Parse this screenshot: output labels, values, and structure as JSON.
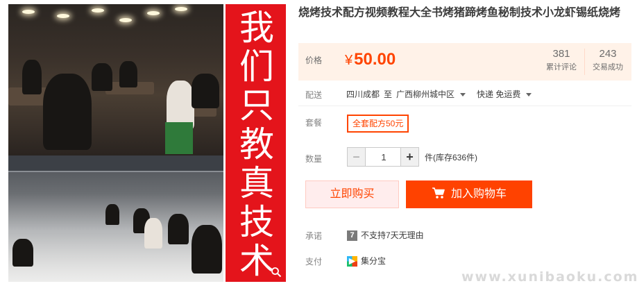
{
  "product": {
    "title": "烧烤技术配方视频教程大全书烤猪蹄烤鱼秘制技术小龙虾锡纸烧烤",
    "banner_text": [
      "我",
      "们",
      "只",
      "教",
      "真",
      "技",
      "术"
    ]
  },
  "price": {
    "label": "价格",
    "currency": "¥",
    "amount": "50.00",
    "reviews_count": "381",
    "reviews_label": "累计评论",
    "deals_count": "243",
    "deals_label": "交易成功"
  },
  "shipping": {
    "label": "配送",
    "from": "四川成都",
    "to_word": "至",
    "destination": "广西柳州城中区",
    "method": "快递 免运费"
  },
  "package": {
    "label": "套餐",
    "selected_option": "全套配方50元"
  },
  "quantity": {
    "label": "数量",
    "minus": "−",
    "plus": "+",
    "value": "1",
    "stock_text": "件(库存636件)"
  },
  "actions": {
    "buy_now": "立即购买",
    "add_to_cart": "加入购物车"
  },
  "promise": {
    "label": "承诺",
    "badge": "7",
    "text": "不支持7天无理由"
  },
  "payment": {
    "label": "支付",
    "method": "集分宝"
  },
  "watermark": "www.xunibaoku.com",
  "colors": {
    "accent": "#ff4400",
    "banner_red": "#e4141b",
    "price_bg": "#fff2e8"
  }
}
